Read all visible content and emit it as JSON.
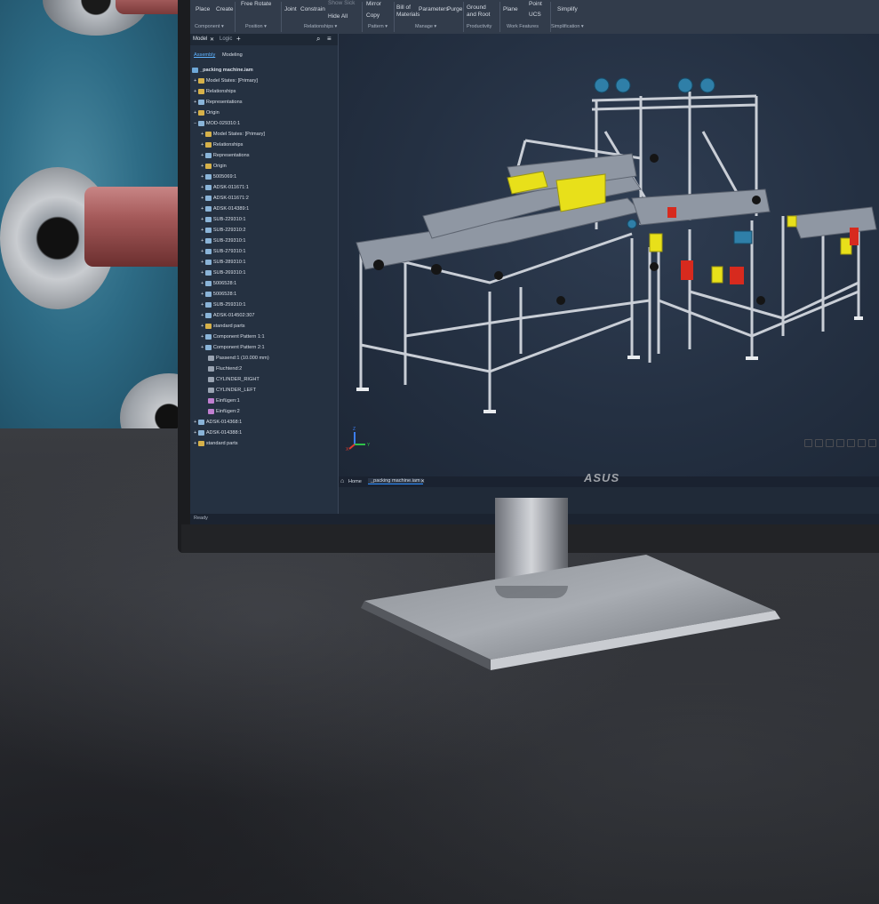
{
  "ribbon": {
    "buttons": [
      "Place",
      "Create",
      "Free Rotate",
      "Joint",
      "Constrain",
      "Show Sick",
      "Hide All",
      "Mirror",
      "Copy",
      "Bill of Materials",
      "Parameters",
      "Purge",
      "Ground and Root",
      "Plane",
      "Point",
      "UCS",
      "Simplify"
    ],
    "groups": [
      "Component ▾",
      "Position ▾",
      "Relationships ▾",
      "Pattern ▾",
      "Manage ▾",
      "Productivity",
      "Work Features",
      "Simplification ▾"
    ]
  },
  "browser": {
    "tabs": [
      "Model",
      "Logic"
    ],
    "modes": [
      "Assembly",
      "Modeling"
    ],
    "items": [
      "_packing machine.iam",
      "Model States: [Primary]",
      "Relationships",
      "Representations",
      "Origin",
      "MOD-029310:1",
      "Model States: [Primary]",
      "Relationships",
      "Representations",
      "Origin",
      "5005069:1",
      "ADSK-011671:1",
      "ADSK-011671:2",
      "ADSK-014389:1",
      "SUB-229310:1",
      "SUB-229310:2",
      "SUB-239310:1",
      "SUB-279310:1",
      "SUB-289310:1",
      "SUB-269310:1",
      "5006528:1",
      "5006528:1",
      "SUB-259310:1",
      "ADSK-014502:307",
      "standard parts",
      "Component Pattern 1:1",
      "Component Pattern 2:1",
      "Passend:1 (10.000 mm)",
      "Fluchtend:2",
      "CYLINDER_RIGHT",
      "CYLINDER_LEFT",
      "Einfügen:1",
      "Einfügen:2",
      "ADSK-014368:1",
      "ADSK-014388:1",
      "standard parts"
    ]
  },
  "doc_tabs": {
    "home": "Home",
    "file": "_packing machine.iam"
  },
  "status": {
    "text": "Ready"
  },
  "axis": {
    "x": "X",
    "y": "Y",
    "z": "Z"
  },
  "brand": {
    "logo": "ASUS"
  },
  "colors": {
    "ribbon": "#323c4b",
    "browser": "#253141",
    "viewport": "#243042",
    "accent_yellow": "#e8e01a",
    "accent_red": "#d72a1e"
  }
}
